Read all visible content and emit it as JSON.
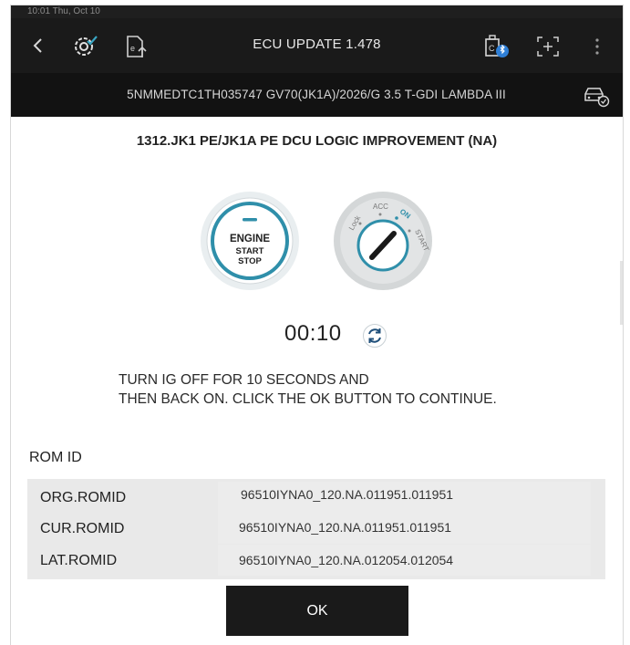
{
  "status_bar": {
    "left_text": "10:01  Thu, Oct 10",
    "right_text": ""
  },
  "app_bar": {
    "title": "ECU UPDATE 1.478"
  },
  "vehicle_bar": {
    "info": "5NMMEDTC1TH035747  GV70(JK1A)/2026/G 3.5 T-GDI LAMBDA III"
  },
  "content": {
    "heading": "1312.JK1 PE/JK1A PE DCU LOGIC IMPROVEMENT (NA)",
    "engine_button": {
      "line1": "ENGINE",
      "line2": "START",
      "line3": "STOP"
    },
    "ignition": {
      "lock": "Lock",
      "acc": "ACC",
      "on": "ON",
      "start": "START"
    },
    "timer": "00:10",
    "instruction_line1": "TURN IG OFF FOR 10 SECONDS AND",
    "instruction_line2": "THEN BACK ON. CLICK THE OK BUTTON TO CONTINUE.",
    "rom_id_label": "ROM ID",
    "rom_rows": [
      {
        "key": "ORG.ROMID",
        "value": "96510IYNA0_120.NA.011951.011951"
      },
      {
        "key": "CUR.ROMID",
        "value": "96510IYNA0_120.NA.011951.011951"
      },
      {
        "key": "LAT.ROMID",
        "value": "96510IYNA0_120.NA.012054.012054"
      }
    ],
    "ok_label": "OK"
  },
  "colors": {
    "accent_teal": "#2f8faa",
    "bluetooth_blue": "#2f7fd6",
    "dark_bar": "#1a1a1a"
  },
  "icons": [
    "back-icon",
    "settings-check-icon",
    "document-upload-icon",
    "vci-bluetooth-icon",
    "capture-icon",
    "more-icon",
    "car-info-icon",
    "refresh-icon",
    "engine-start-stop-icon",
    "ignition-key-icon"
  ]
}
